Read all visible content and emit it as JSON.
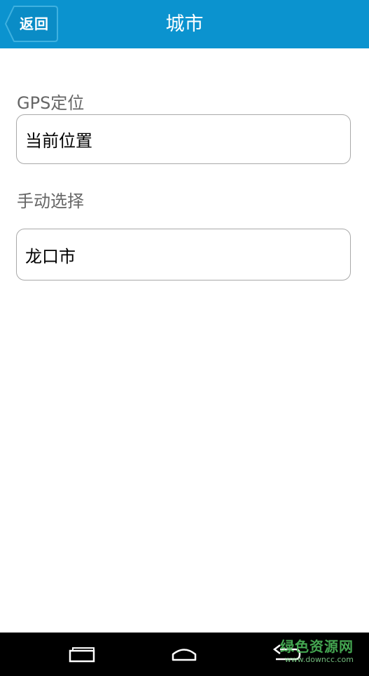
{
  "header": {
    "back_label": "返回",
    "title": "城市",
    "bar_color": "#0b93cf"
  },
  "gps": {
    "label": "GPS定位",
    "value": "当前位置"
  },
  "manual": {
    "label": "手动选择",
    "value": "龙口市"
  },
  "navbar": {
    "recent_icon": "recent-apps-icon",
    "home_icon": "home-icon",
    "back_icon": "back-arrow-icon"
  },
  "watermark": {
    "main": "绿色资源网",
    "sub": "www.downcc.com"
  }
}
